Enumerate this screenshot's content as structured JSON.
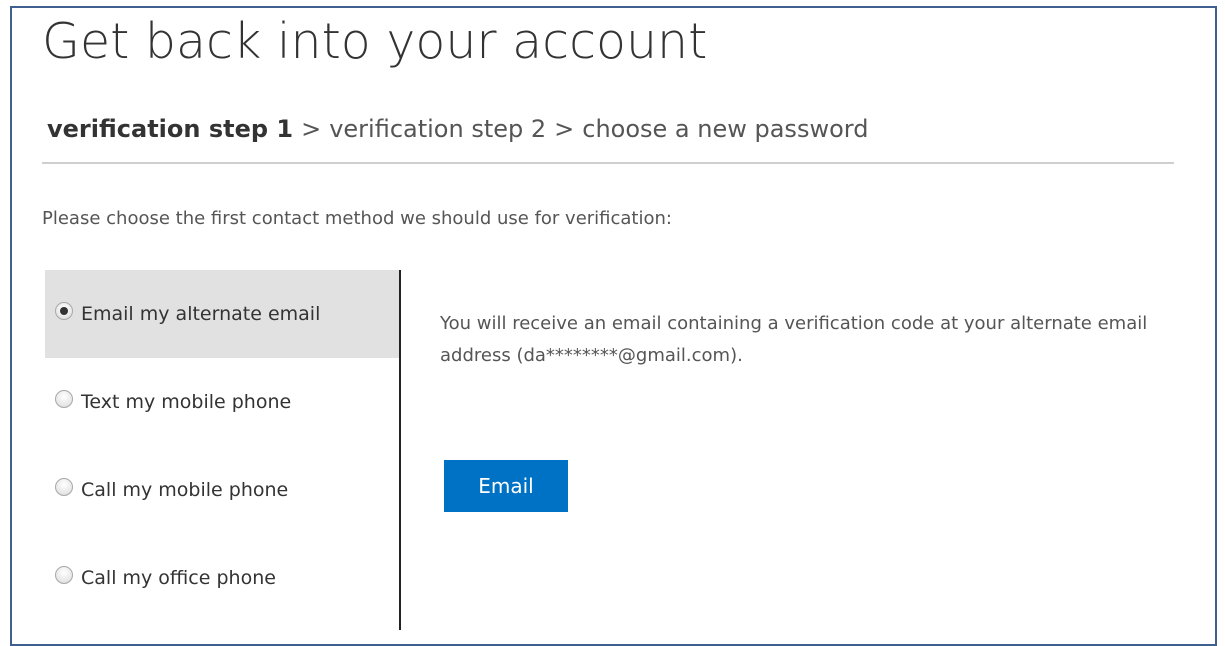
{
  "page": {
    "title": "Get back into your account"
  },
  "breadcrumb": {
    "step1": "verification step 1",
    "step2": "verification step 2",
    "step3": "choose a new password",
    "separator": ">"
  },
  "instruction": "Please choose the first contact method we should use for verification:",
  "contact_methods": [
    {
      "label": "Email my alternate email",
      "selected": true
    },
    {
      "label": "Text my mobile phone",
      "selected": false
    },
    {
      "label": "Call my mobile phone",
      "selected": false
    },
    {
      "label": "Call my office phone",
      "selected": false
    }
  ],
  "detail": {
    "description": "You will receive an email containing a verification code at your alternate email address (da********@gmail.com).",
    "button_label": "Email"
  },
  "colors": {
    "accent": "#0072c6",
    "selected_bg": "#e1e1e1",
    "frame_border": "#3f5f8f"
  }
}
